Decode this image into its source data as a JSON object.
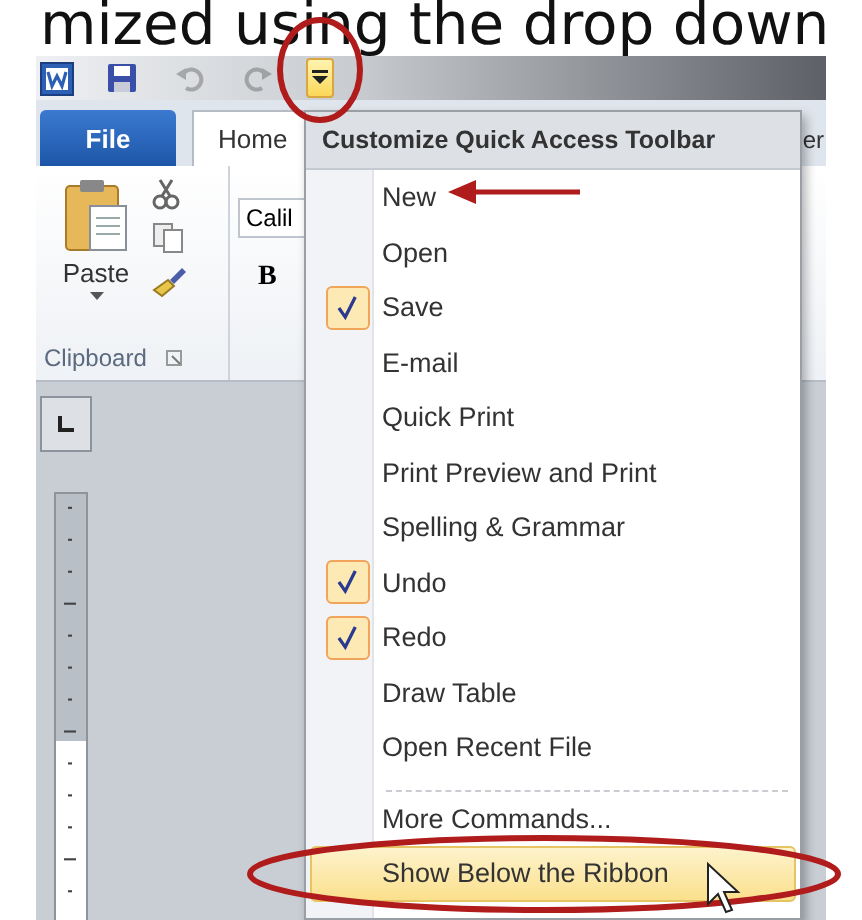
{
  "caption": "mized using the drop down",
  "quick_access_toolbar": [
    {
      "kind": "save",
      "disabled": false,
      "active": false
    },
    {
      "kind": "undo",
      "disabled": true,
      "active": false
    },
    {
      "kind": "redo",
      "disabled": true,
      "active": false
    },
    {
      "kind": "customize",
      "disabled": false,
      "active": true
    }
  ],
  "ribbon_tabs": [
    {
      "kind": "backstage",
      "label": "File"
    },
    {
      "kind": "tab",
      "label": "Home",
      "selected": true
    },
    {
      "kind": "tab",
      "label": "er",
      "selected": false
    }
  ],
  "clipboard_group": {
    "paste_label": "Paste",
    "group_label": "Clipboard"
  },
  "font_group": {
    "font_name": "Calil",
    "bold_label": "B"
  },
  "menu": {
    "title": "Customize Quick Access Toolbar",
    "items": [
      {
        "kind": "item",
        "label": "New",
        "checked": false,
        "selected": false
      },
      {
        "kind": "item",
        "label": "Open",
        "checked": false,
        "selected": false
      },
      {
        "kind": "item",
        "label": "Save",
        "checked": true,
        "selected": false
      },
      {
        "kind": "item",
        "label": "E-mail",
        "checked": false,
        "selected": false
      },
      {
        "kind": "item",
        "label": "Quick Print",
        "checked": false,
        "selected": false
      },
      {
        "kind": "item",
        "label": "Print Preview and Print",
        "checked": false,
        "selected": false
      },
      {
        "kind": "item",
        "label": "Spelling & Grammar",
        "checked": false,
        "selected": false
      },
      {
        "kind": "item",
        "label": "Undo",
        "checked": true,
        "selected": false
      },
      {
        "kind": "item",
        "label": "Redo",
        "checked": true,
        "selected": false
      },
      {
        "kind": "item",
        "label": "Draw Table",
        "checked": false,
        "selected": false
      },
      {
        "kind": "item",
        "label": "Open Recent File",
        "checked": false,
        "selected": false
      },
      {
        "kind": "separator"
      },
      {
        "kind": "item",
        "label": "More Commands...",
        "checked": false,
        "selected": false
      },
      {
        "kind": "item",
        "label": "Show Below the Ribbon",
        "checked": false,
        "selected": true
      }
    ]
  }
}
